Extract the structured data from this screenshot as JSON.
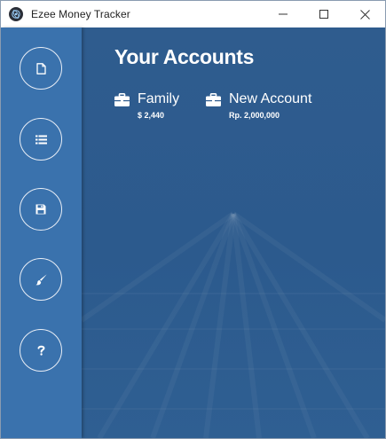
{
  "window": {
    "title": "Ezee Money Tracker"
  },
  "sidebar": {
    "items": [
      {
        "icon": "file-icon",
        "label": "New"
      },
      {
        "icon": "list-icon",
        "label": "Accounts"
      },
      {
        "icon": "save-icon",
        "label": "Save"
      },
      {
        "icon": "brush-icon",
        "label": "Theme"
      },
      {
        "icon": "question-icon",
        "label": "Help"
      }
    ]
  },
  "main": {
    "heading": "Your Accounts",
    "accounts": [
      {
        "name": "Family",
        "balance": "$ 2,440",
        "icon": "briefcase-icon"
      },
      {
        "name": "New Account",
        "balance": "Rp. 2,000,000",
        "icon": "briefcase-icon"
      }
    ]
  },
  "colors": {
    "sidebar": "#3a72ad",
    "main_background": "#2f5c8e",
    "text": "#ffffff"
  }
}
